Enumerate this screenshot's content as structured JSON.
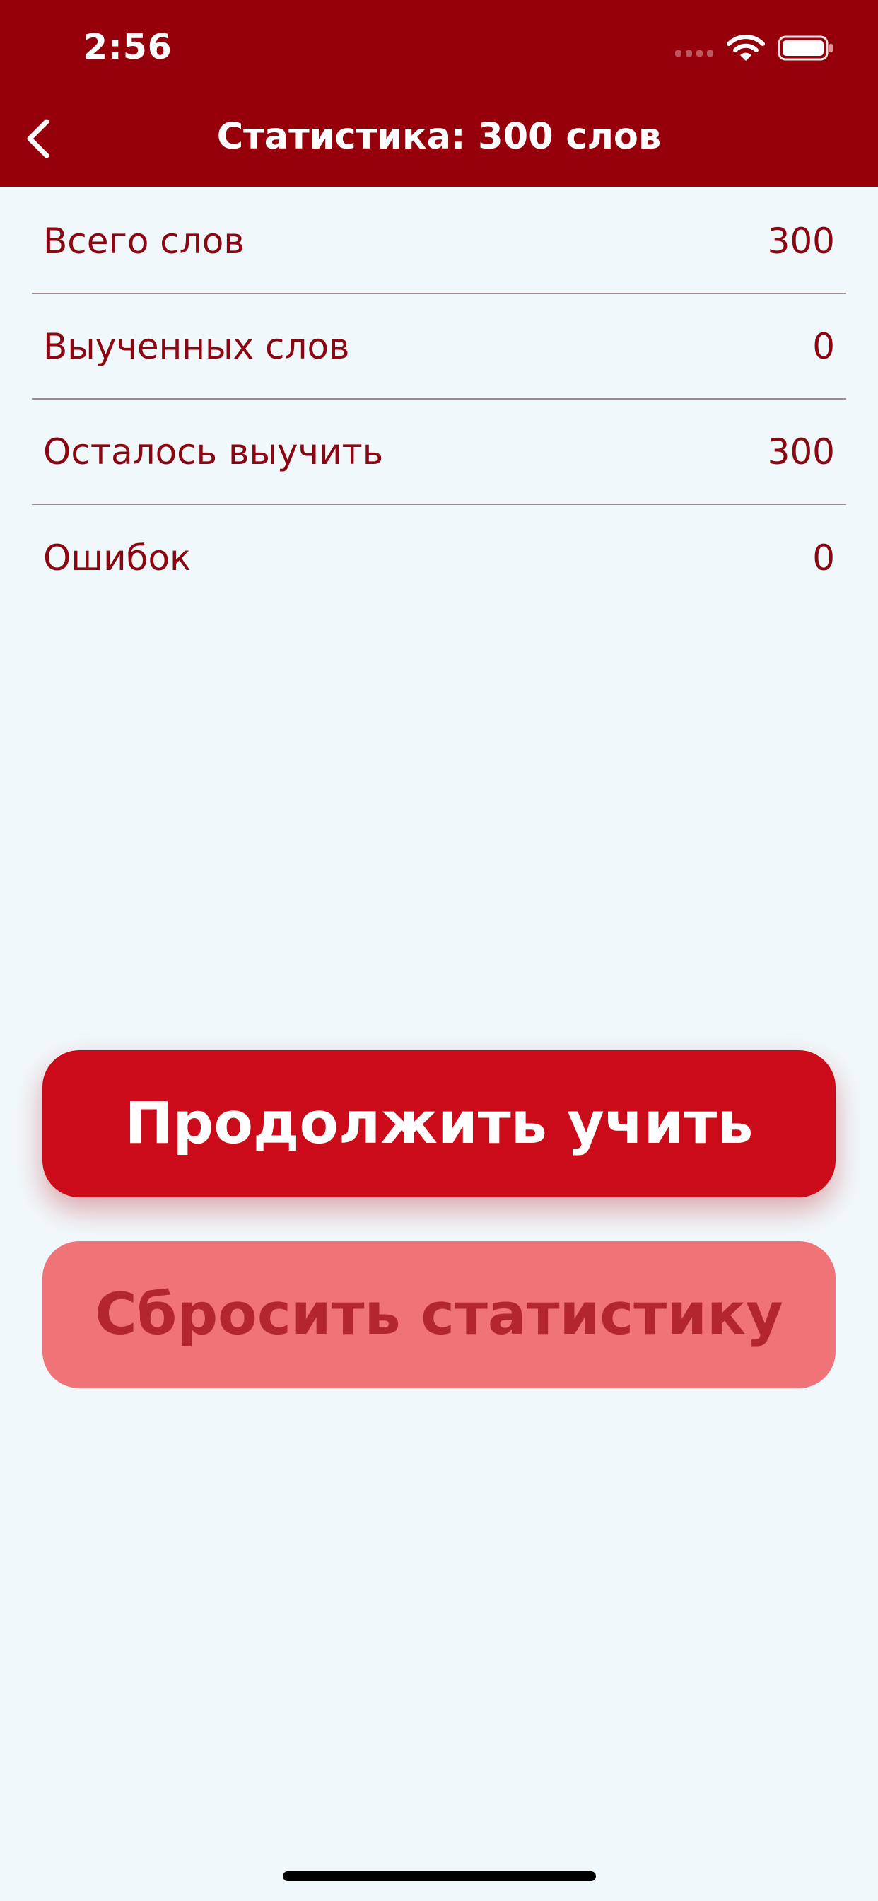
{
  "status_bar": {
    "time": "2:56",
    "wifi_icon": "wifi-icon",
    "battery_icon": "battery-icon"
  },
  "nav": {
    "back_icon": "chevron-left-icon",
    "title": "Статистика: 300 слов"
  },
  "stats": [
    {
      "label": "Всего слов",
      "value": "300"
    },
    {
      "label": "Выученных слов",
      "value": "0"
    },
    {
      "label": "Осталось выучить",
      "value": "300"
    },
    {
      "label": "Ошибок",
      "value": "0"
    }
  ],
  "buttons": {
    "continue_label": "Продолжить учить",
    "reset_label": "Сбросить статистику"
  },
  "colors": {
    "header": "#95000A",
    "background": "#F1F8FB",
    "text": "#8A0611",
    "primary_button": "#CB0B19",
    "secondary_button": "#F07378",
    "secondary_button_text": "#B3262F"
  }
}
